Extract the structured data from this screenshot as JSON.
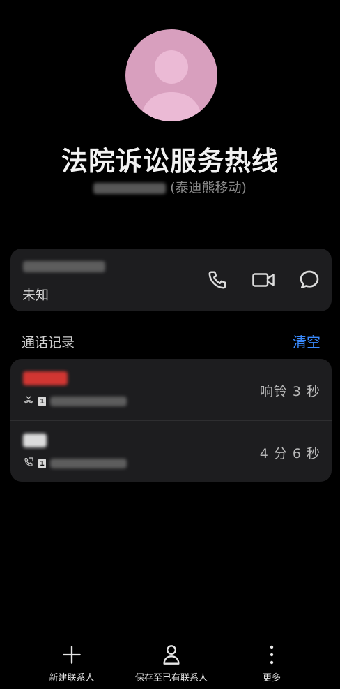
{
  "contact": {
    "name": "法院诉讼服务热线",
    "carrier": "(泰迪熊移动)",
    "location": "未知",
    "avatar_color": "#d89fbe"
  },
  "actions": [
    "phone-icon",
    "video-call-icon",
    "message-icon"
  ],
  "call_log": {
    "title": "通话记录",
    "clear_label": "清空",
    "entries": [
      {
        "duration": "响铃 3 秒",
        "type": "missed",
        "tag_color": "#e53935"
      },
      {
        "duration": "4 分 6 秒",
        "type": "outgoing",
        "tag_color": "#e0e0e0"
      }
    ]
  },
  "bottom_bar": {
    "new_contact": "新建联系人",
    "save_existing": "保存至已有联系人",
    "more": "更多"
  },
  "colors": {
    "accent": "#3a8bff",
    "card": "#1d1d1f",
    "background": "#000000"
  }
}
